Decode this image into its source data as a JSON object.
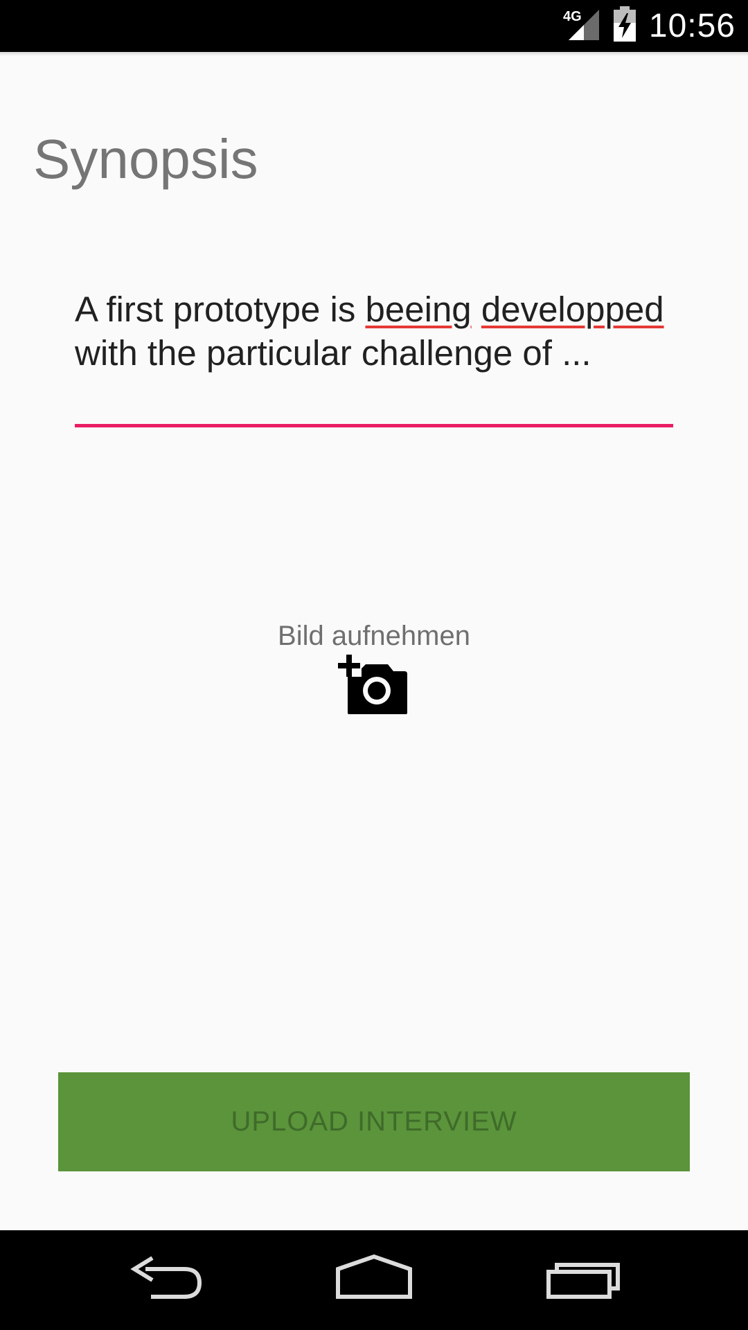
{
  "status_bar": {
    "network": "4G",
    "time": "10:56",
    "icons": [
      "signal-icon",
      "battery-charging-icon"
    ]
  },
  "page": {
    "title": "Synopsis"
  },
  "synopsis": {
    "before_misspelling": "A first prototype is ",
    "misspelled_1": "beeing",
    "line_break_space": " ",
    "misspelled_2": "developped",
    "after_misspelling": " with the particular challenge of ..."
  },
  "photo": {
    "label": "Bild aufnehmen",
    "icon": "add-photo-icon"
  },
  "upload": {
    "label": "UPLOAD INTERVIEW"
  },
  "navigation": {
    "icons": [
      "back-icon",
      "home-icon",
      "recents-icon"
    ]
  },
  "colors": {
    "accent": "#e91e63",
    "button": "#5b943b",
    "button_text": "#3f6b2a",
    "title": "#757575"
  }
}
